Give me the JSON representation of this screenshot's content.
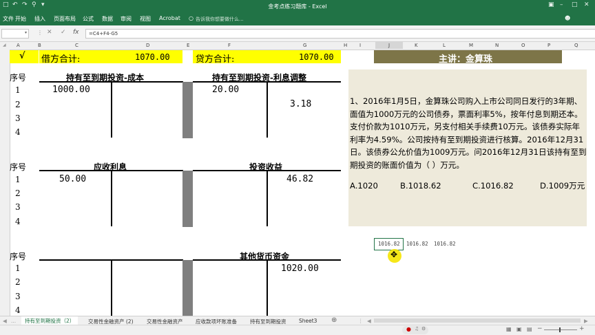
{
  "window": {
    "title": "金考点练习题库 - Excel"
  },
  "ribbon": {
    "tabs": [
      "开始",
      "插入",
      "页面布局",
      "公式",
      "数据",
      "审阅",
      "视图",
      "Acrobat"
    ],
    "search_placeholder": "告诉我你想要做什么..."
  },
  "formula_bar": {
    "formula": "=C4+F4-G5"
  },
  "columns": [
    "A",
    "B",
    "C",
    "D",
    "E",
    "F",
    "G",
    "H",
    "I",
    "J",
    "K",
    "L",
    "M",
    "N",
    "O",
    "P",
    "Q"
  ],
  "sheet": {
    "checkmark": "√",
    "debit_label": "借方合计:",
    "debit_value": "1070.00",
    "credit_label": "贷方合计:",
    "credit_value": "1070.00",
    "lecturer": "主讲：金算珠",
    "seq_label": "序号",
    "row_numbers": [
      "1",
      "2",
      "3",
      "4"
    ],
    "t1_left_title": "持有至到期投资-成本",
    "t1_right_title": "持有至到期投资-利息调整",
    "t1_left_debit": "1000.00",
    "t1_right_debit": "20.00",
    "t1_right_credit": "3.18",
    "t2_left_title": "应收利息",
    "t2_right_title": "投资收益",
    "t2_left_debit": "50.00",
    "t2_right_credit": "46.82",
    "t3_right_title": "其他货币资金",
    "t3_right_credit": "1020.00",
    "small_values": [
      "1016.82",
      "1016.82",
      "1016.82"
    ]
  },
  "question": {
    "text": "1、2016年1月5日，金算珠公司购入上市公司同日发行的3年期、面值为1000万元的公司债券，票面利率5%，按年付息到期还本。支付价款为1010万元，另支付相关手续费10万元。该债券实际年利率为4.59%。公司按持有至到期投资进行核算。2016年12月31日。该债券公允价值为1009万元。问2016年12月31日该持有至到期投资的账面价值为（    ）万元。",
    "options": [
      "A.1020",
      "B.1018.62",
      "C.1016.82",
      "D.1009万元"
    ]
  },
  "sheet_tabs": [
    "持有至到期投资（2）",
    "交易性金融资产 (2)",
    "交易性金融资产",
    "应收款项坏账准备",
    "持有至到期投资",
    "Sheet3"
  ],
  "colors": {
    "excel_green": "#217346",
    "highlight_yellow": "#ffff00",
    "header_olive": "#7d7548",
    "panel_beige": "#eeeadb",
    "cursor_yellow": "#f5e400"
  }
}
